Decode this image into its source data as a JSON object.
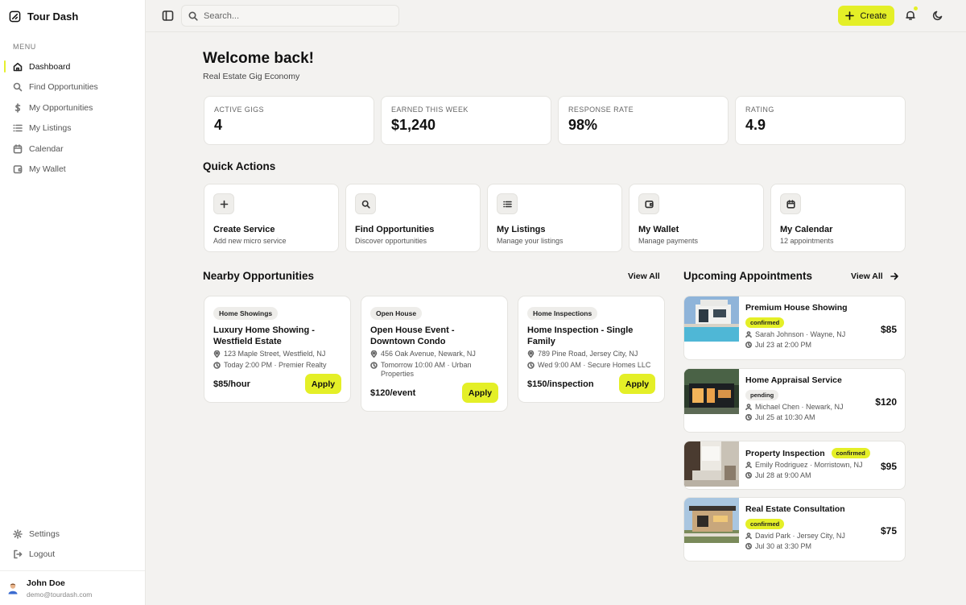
{
  "app": {
    "brand": "Tour Dash"
  },
  "sidebar": {
    "menu_title": "MENU",
    "items": [
      {
        "label": "Dashboard",
        "icon": "home-icon",
        "active": true
      },
      {
        "label": "Find Opportunities",
        "icon": "search-icon"
      },
      {
        "label": "My Opportunities",
        "icon": "dollar-icon"
      },
      {
        "label": "My Listings",
        "icon": "list-icon"
      },
      {
        "label": "Calendar",
        "icon": "calendar-icon"
      },
      {
        "label": "My Wallet",
        "icon": "wallet-icon"
      }
    ],
    "bottom": [
      {
        "label": "Settings",
        "icon": "gear-icon"
      },
      {
        "label": "Logout",
        "icon": "logout-icon"
      }
    ],
    "user": {
      "name": "John Doe",
      "email": "demo@tourdash.com"
    }
  },
  "topbar": {
    "search_placeholder": "Search...",
    "create_label": "Create"
  },
  "header": {
    "welcome": "Welcome back!",
    "subtitle": "Real Estate Gig Economy"
  },
  "stats": [
    {
      "label": "ACTIVE GIGS",
      "value": "4"
    },
    {
      "label": "EARNED THIS WEEK",
      "value": "$1,240"
    },
    {
      "label": "RESPONSE RATE",
      "value": "98%"
    },
    {
      "label": "RATING",
      "value": "4.9"
    }
  ],
  "quick_actions": {
    "title": "Quick Actions",
    "items": [
      {
        "title": "Create Service",
        "sub": "Add new micro service",
        "icon": "plus-icon"
      },
      {
        "title": "Find Opportunities",
        "sub": "Discover opportunities",
        "icon": "search-icon"
      },
      {
        "title": "My Listings",
        "sub": "Manage your listings",
        "icon": "list-icon"
      },
      {
        "title": "My Wallet",
        "sub": "Manage payments",
        "icon": "wallet-icon"
      },
      {
        "title": "My Calendar",
        "sub": "12 appointments",
        "icon": "calendar-icon"
      }
    ]
  },
  "nearby": {
    "title": "Nearby Opportunities",
    "view_all": "View All",
    "items": [
      {
        "tag": "Home Showings",
        "title": "Luxury Home Showing - Westfield Estate",
        "address": "123 Maple Street, Westfield, NJ",
        "time": "Today 2:00 PM · Premier Realty",
        "price": "$85/hour",
        "apply": "Apply"
      },
      {
        "tag": "Open House",
        "title": "Open House Event - Downtown Condo",
        "address": "456 Oak Avenue, Newark, NJ",
        "time": "Tomorrow 10:00 AM · Urban Properties",
        "price": "$120/event",
        "apply": "Apply"
      },
      {
        "tag": "Home Inspections",
        "title": "Home Inspection - Single Family",
        "address": "789 Pine Road, Jersey City, NJ",
        "time": "Wed 9:00 AM · Secure Homes LLC",
        "price": "$150/inspection",
        "apply": "Apply"
      }
    ]
  },
  "appointments": {
    "title": "Upcoming Appointments",
    "view_all": "View All",
    "items": [
      {
        "title": "Premium House Showing",
        "status": "confirmed",
        "person": "Sarah Johnson · Wayne, NJ",
        "time": "Jul 23 at 2:00 PM",
        "price": "$85"
      },
      {
        "title": "Home Appraisal Service",
        "status": "pending",
        "person": "Michael Chen · Newark, NJ",
        "time": "Jul 25 at 10:30 AM",
        "price": "$120"
      },
      {
        "title": "Property Inspection",
        "status": "confirmed",
        "person": "Emily Rodriguez · Morristown, NJ",
        "time": "Jul 28 at 9:00 AM",
        "price": "$95"
      },
      {
        "title": "Real Estate Consultation",
        "status": "confirmed",
        "person": "David Park · Jersey City, NJ",
        "time": "Jul 30 at 3:30 PM",
        "price": "$75"
      }
    ]
  },
  "colors": {
    "accent": "#e4ef27",
    "background": "#f3f2f0",
    "card": "#ffffff"
  }
}
